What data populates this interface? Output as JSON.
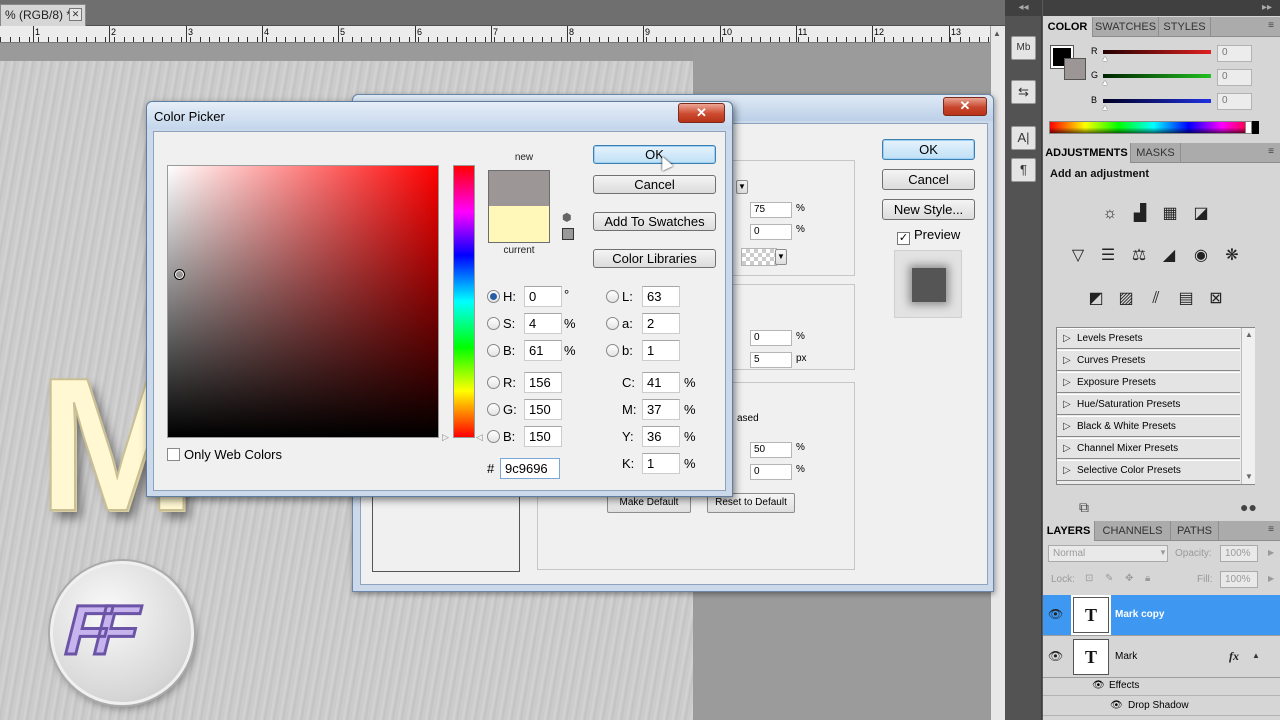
{
  "document": {
    "tab_title": "% (RGB/8) *",
    "tab_close_icon": "close-icon",
    "ruler_numbers": [
      "1",
      "2",
      "3",
      "4",
      "5",
      "6",
      "7",
      "8",
      "9",
      "10",
      "11",
      "12",
      "13"
    ],
    "canvas_text": "M",
    "logo_text": "FF"
  },
  "layer_style": {
    "close_label": "✕",
    "ok_label": "OK",
    "cancel_label": "Cancel",
    "new_style_label": "New Style...",
    "preview_label": "Preview",
    "preview_checked": true,
    "fields": {
      "v1": "75",
      "v2": "0",
      "v3": "0",
      "v4": "5",
      "v5": "50",
      "v6": "0"
    },
    "units": {
      "pct": "%",
      "px": "px"
    },
    "ased_label": "ased",
    "make_default_label": "Make Default",
    "reset_default_label": "Reset to Default"
  },
  "color_picker": {
    "title": "Color Picker",
    "close_label": "✕",
    "ok_label": "OK",
    "cancel_label": "Cancel",
    "add_swatches_label": "Add To Swatches",
    "libraries_label": "Color Libraries",
    "new_label": "new",
    "current_label": "current",
    "new_color": "#9c9696",
    "current_color": "#fff8b9",
    "only_web_colors_label": "Only Web Colors",
    "hsb": [
      {
        "label": "H:",
        "value": "0",
        "unit": "°",
        "selected": true
      },
      {
        "label": "S:",
        "value": "4",
        "unit": "%",
        "selected": false
      },
      {
        "label": "B:",
        "value": "61",
        "unit": "%",
        "selected": false
      }
    ],
    "rgb": [
      {
        "label": "R:",
        "value": "156"
      },
      {
        "label": "G:",
        "value": "150"
      },
      {
        "label": "B:",
        "value": "150"
      }
    ],
    "lab": [
      {
        "label": "L:",
        "value": "63"
      },
      {
        "label": "a:",
        "value": "2"
      },
      {
        "label": "b:",
        "value": "1"
      }
    ],
    "cmyk": [
      {
        "label": "C:",
        "value": "41",
        "unit": "%"
      },
      {
        "label": "M:",
        "value": "37",
        "unit": "%"
      },
      {
        "label": "Y:",
        "value": "36",
        "unit": "%"
      },
      {
        "label": "K:",
        "value": "1",
        "unit": "%"
      }
    ],
    "hex_label": "#",
    "hex_value": "9c9696"
  },
  "dock": {
    "collapse_label": "◂◂",
    "tools": [
      "Mb",
      "⇆",
      "A|",
      "¶"
    ]
  },
  "panels": {
    "collapse_label": "▸▸",
    "color_tabs": [
      "COLOR",
      "SWATCHES",
      "STYLES"
    ],
    "sliders": [
      {
        "label": "R",
        "value": "0",
        "color": "#e02020"
      },
      {
        "label": "G",
        "value": "0",
        "color": "#20c020"
      },
      {
        "label": "B",
        "value": "0",
        "color": "#2030e0"
      }
    ],
    "adjust_tabs": [
      "ADJUSTMENTS",
      "MASKS"
    ],
    "add_adjustment_label": "Add an adjustment",
    "adjust_icons_row1": [
      "brightness-icon",
      "levels-icon",
      "curves-icon",
      "exposure-icon"
    ],
    "adjust_icons_row2": [
      "vibrance-icon",
      "hue-saturation-icon",
      "color-balance-icon",
      "black-white-icon",
      "photo-filter-icon",
      "channel-mixer-icon"
    ],
    "adjust_icons_row3": [
      "invert-icon",
      "posterize-icon",
      "threshold-icon",
      "gradient-map-icon",
      "selective-color-icon"
    ],
    "presets": [
      "Levels Presets",
      "Curves Presets",
      "Exposure Presets",
      "Hue/Saturation Presets",
      "Black & White Presets",
      "Channel Mixer Presets",
      "Selective Color Presets"
    ],
    "layer_tabs": [
      "LAYERS",
      "CHANNELS",
      "PATHS"
    ],
    "blend_mode": "Normal",
    "opacity_label": "Opacity:",
    "opacity_value": "100%",
    "lock_label": "Lock:",
    "fill_label": "Fill:",
    "fill_value": "100%",
    "layers": [
      {
        "name": "Mark copy",
        "thumb": "T",
        "selected": true,
        "fx": ""
      },
      {
        "name": "Mark",
        "thumb": "T",
        "selected": false,
        "fx": "fx"
      }
    ],
    "effects_label": "Effects",
    "drop_shadow_label": "Drop Shadow"
  }
}
